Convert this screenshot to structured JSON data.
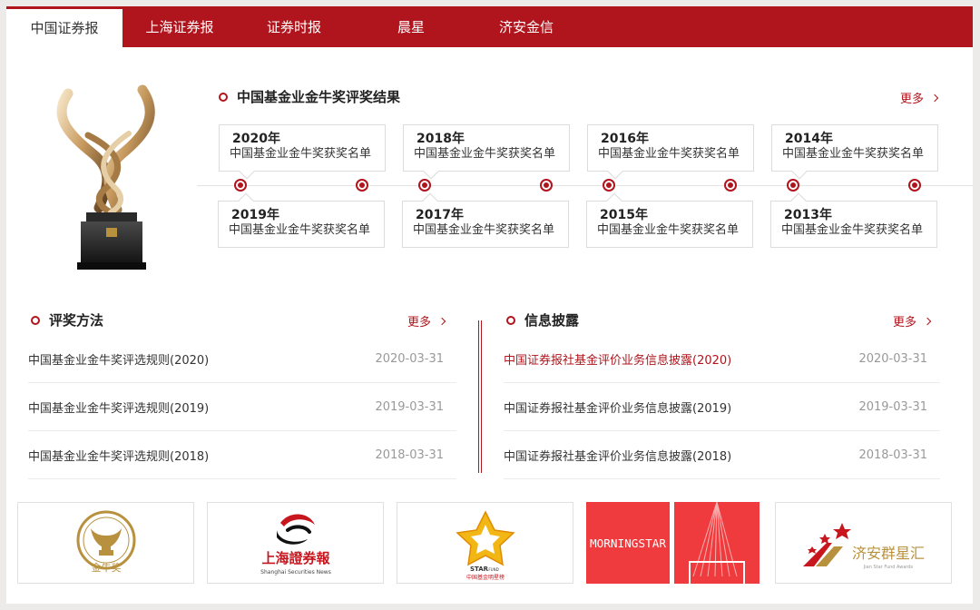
{
  "nav": {
    "tabs": [
      {
        "label": "中国证券报",
        "active": true
      },
      {
        "label": "上海证券报"
      },
      {
        "label": "证券时报"
      },
      {
        "label": "晨星"
      },
      {
        "label": "济安金信"
      }
    ]
  },
  "awards": {
    "title": "中国基金业金牛奖评奖结果",
    "more": "更多",
    "top_items": [
      {
        "year": "2020年",
        "name": "中国基金业金牛奖获奖名单"
      },
      {
        "year": "2018年",
        "name": "中国基金业金牛奖获奖名单"
      },
      {
        "year": "2016年",
        "name": "中国基金业金牛奖获奖名单"
      },
      {
        "year": "2014年",
        "name": "中国基金业金牛奖获奖名单"
      }
    ],
    "bottom_items": [
      {
        "year": "2019年",
        "name": "中国基金业金牛奖获奖名单"
      },
      {
        "year": "2017年",
        "name": "中国基金业金牛奖获奖名单"
      },
      {
        "year": "2015年",
        "name": "中国基金业金牛奖获奖名单"
      },
      {
        "year": "2013年",
        "name": "中国基金业金牛奖获奖名单"
      }
    ]
  },
  "methods": {
    "title": "评奖方法",
    "more": "更多",
    "rows": [
      {
        "title": "中国基金业金牛奖评选规则(2020)",
        "date": "2020-03-31"
      },
      {
        "title": "中国基金业金牛奖评选规则(2019)",
        "date": "2019-03-31"
      },
      {
        "title": "中国基金业金牛奖评选规则(2018)",
        "date": "2018-03-31"
      }
    ]
  },
  "disclosure": {
    "title": "信息披露",
    "more": "更多",
    "rows": [
      {
        "title": "中国证券报社基金评价业务信息披露(2020)",
        "date": "2020-03-31"
      },
      {
        "title": "中国证券报社基金评价业务信息披露(2019)",
        "date": "2019-03-31"
      },
      {
        "title": "中国证券报社基金评价业务信息披露(2018)",
        "date": "2018-03-31"
      }
    ]
  },
  "logos": {
    "jinniu": {
      "text": "金牛奖"
    },
    "shsec": {
      "cn": "上海證券報",
      "en": "Shanghai Securities News"
    },
    "star": {
      "en": "STAR",
      "sub": "FUND",
      "cn": "中国基金明星榜"
    },
    "morningstar": {
      "text": "MORNINGSTAR"
    },
    "jian": {
      "cn": "济安群星汇",
      "en": "Jian Star Fund Awards"
    }
  },
  "colors": {
    "brand_red": "#b0141c",
    "gold": "#b8913e"
  }
}
